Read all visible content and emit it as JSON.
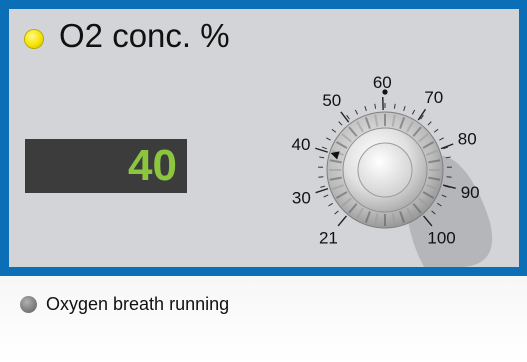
{
  "panel": {
    "title": "O2 conc. %",
    "indicator_color": "#f6e400",
    "frame_color": "#0a6fb6",
    "readout_value": "40",
    "readout_color": "#8cc63f"
  },
  "dial": {
    "current_value": 40,
    "scale_labels": [
      "21",
      "30",
      "40",
      "50",
      "60",
      "70",
      "80",
      "90",
      "100"
    ]
  },
  "status": {
    "icon": "status-dot-icon",
    "text": "Oxygen breath running"
  }
}
